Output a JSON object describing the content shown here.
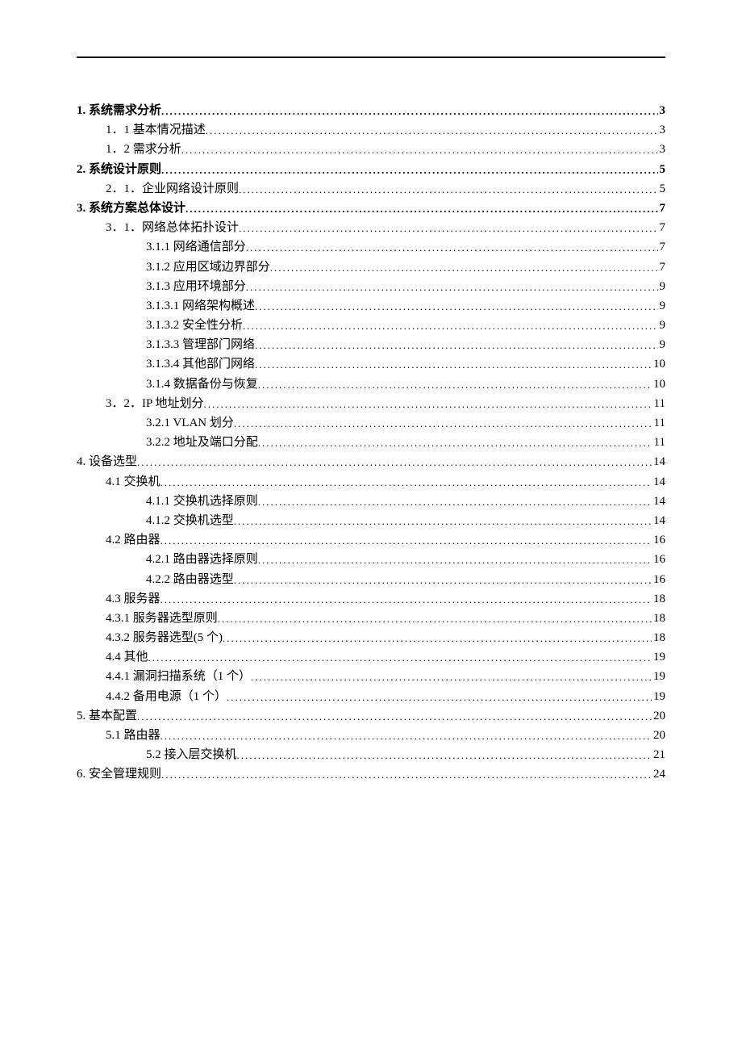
{
  "toc": [
    {
      "label": "1.  系统需求分析",
      "page": "3",
      "indent": 0,
      "bold": true
    },
    {
      "label": "1．1 基本情况描述",
      "page": "3",
      "indent": 1,
      "bold": false
    },
    {
      "label": "1．2 需求分析",
      "page": "3",
      "indent": 1,
      "bold": false
    },
    {
      "label": "2.  系统设计原则",
      "page": "5",
      "indent": 0,
      "bold": true
    },
    {
      "label": "2．1．企业网络设计原则",
      "page": "5",
      "indent": 1,
      "bold": false
    },
    {
      "label": "3.  系统方案总体设计",
      "page": "7",
      "indent": 0,
      "bold": true
    },
    {
      "label": "3．1．网络总体拓扑设计",
      "page": "7",
      "indent": 1,
      "bold": false
    },
    {
      "label": "3.1.1  网络通信部分 ",
      "page": "7",
      "indent": 2,
      "bold": false
    },
    {
      "label": "3.1.2  应用区域边界部分 ",
      "page": "7",
      "indent": 2,
      "bold": false
    },
    {
      "label": "3.1.3   应用环境部分",
      "page": "9",
      "indent": 2,
      "bold": false
    },
    {
      "label": "3.1.3.1  网络架构概述 ",
      "page": "9",
      "indent": 2,
      "bold": false
    },
    {
      "label": "3.1.3.2  安全性分析 ",
      "page": "9",
      "indent": 2,
      "bold": false
    },
    {
      "label": "3.1.3.3  管理部门网络 ",
      "page": "9",
      "indent": 2,
      "bold": false
    },
    {
      "label": "3.1.3.4  其他部门网络 ",
      "page": "10",
      "indent": 2,
      "bold": false
    },
    {
      "label": "3.1.4  数据备份与恢复 ",
      "page": "10",
      "indent": 2,
      "bold": false
    },
    {
      "label": "3．2．IP 地址划分",
      "page": "11",
      "indent": 1,
      "bold": false
    },
    {
      "label": "3.2.1 VLAN 划分 ",
      "page": "11",
      "indent": 2,
      "bold": false
    },
    {
      "label": "3.2.2 地址及端口分配 ",
      "page": "11",
      "indent": 2,
      "bold": false
    },
    {
      "label": "4. 设备选型",
      "page": "14",
      "indent": 0,
      "bold": false
    },
    {
      "label": "4.1 交换机",
      "page": "14",
      "indent": 1,
      "bold": false
    },
    {
      "label": "4.1.1 交换机选择原则 ",
      "page": "14",
      "indent": 2,
      "bold": false
    },
    {
      "label": "4.1.2  交换机选型 ",
      "page": "14",
      "indent": 2,
      "bold": false
    },
    {
      "label": "4.2 路由器",
      "page": "16",
      "indent": 1,
      "bold": false
    },
    {
      "label": "4.2.1 路由器选择原则 ",
      "page": "16",
      "indent": 2,
      "bold": false
    },
    {
      "label": "4.2.2 路由器选型 ",
      "page": "16",
      "indent": 2,
      "bold": false
    },
    {
      "label": "4.3  服务器",
      "page": "18",
      "indent": 1,
      "bold": false
    },
    {
      "label": "4.3.1 服务器选型原则 ",
      "page": "18",
      "indent": 1,
      "bold": false
    },
    {
      "label": "4.3.2 服务器选型(5 个)",
      "page": "18",
      "indent": 1,
      "bold": false
    },
    {
      "label": "4.4  其他",
      "page": "19",
      "indent": 1,
      "bold": false
    },
    {
      "label": "4.4.1  漏洞扫描系统（1 个） ",
      "page": "19",
      "indent": 1,
      "bold": false
    },
    {
      "label": "4.4.2  备用电源（1 个） ",
      "page": "19",
      "indent": 1,
      "bold": false
    },
    {
      "label": "5. 基本配置",
      "page": "20",
      "indent": 0,
      "bold": false
    },
    {
      "label": "5.1 路由器 ",
      "page": "20",
      "indent": 1,
      "bold": false
    },
    {
      "label": "5.2 接入层交换机",
      "page": "21",
      "indent": 2,
      "bold": false
    },
    {
      "label": "6. 安全管理规则",
      "page": "24",
      "indent": 0,
      "bold": false
    }
  ]
}
